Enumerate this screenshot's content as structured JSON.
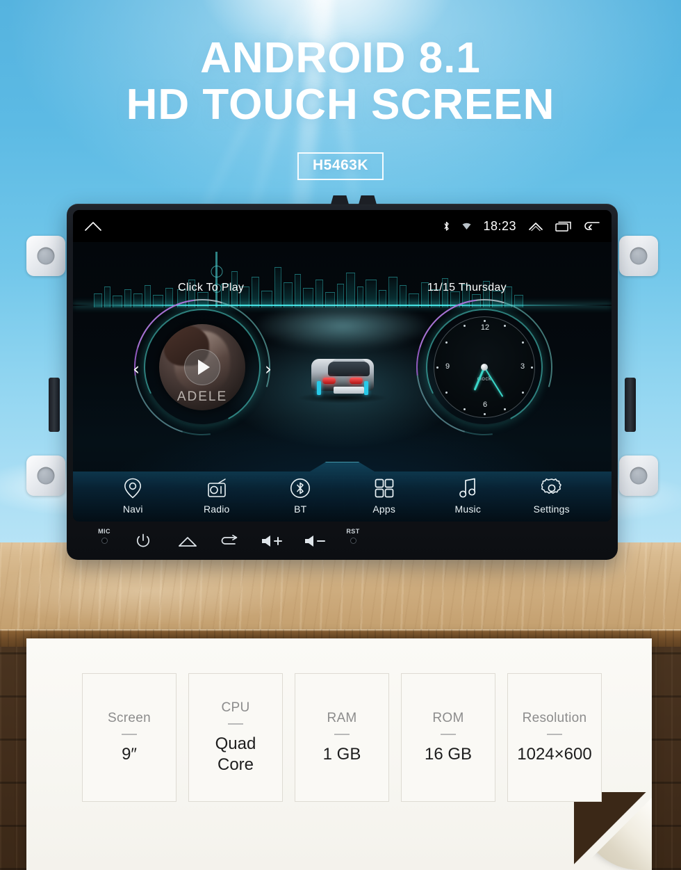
{
  "hero": {
    "line1": "ANDROID 8.1",
    "line2": "HD TOUCH SCREEN",
    "model": "H5463K"
  },
  "device": {
    "statusbar": {
      "home_icon": "home-icon",
      "bluetooth_icon": "bluetooth-icon",
      "wifi_icon": "wifi-icon",
      "time": "18:23",
      "expand_icon": "chevron-up-icon",
      "recents_icon": "recents-icon",
      "back_icon": "back-arrow-icon"
    },
    "music_widget": {
      "title": "Click To Play",
      "album_artist": "ADELE",
      "play_icon": "play-icon",
      "prev_icon": "chevron-left-icon",
      "next_icon": "chevron-right-icon"
    },
    "clock_widget": {
      "date": "11/15  Thursday",
      "face_label": "clock",
      "hour_marks": [
        "12",
        "3",
        "6",
        "9"
      ]
    },
    "dock": [
      {
        "label": "Navi",
        "icon": "location-pin-icon"
      },
      {
        "label": "Radio",
        "icon": "radio-icon"
      },
      {
        "label": "BT",
        "icon": "bluetooth-icon"
      },
      {
        "label": "Apps",
        "icon": "apps-grid-icon"
      },
      {
        "label": "Music",
        "icon": "music-note-icon"
      },
      {
        "label": "Settings",
        "icon": "gear-icon"
      }
    ],
    "buttons": [
      {
        "label": "MIC",
        "icon": "mic-pinhole-icon"
      },
      {
        "label": "",
        "icon": "power-icon"
      },
      {
        "label": "",
        "icon": "home-icon"
      },
      {
        "label": "",
        "icon": "return-arrow-icon"
      },
      {
        "label": "",
        "icon": "volume-up-icon"
      },
      {
        "label": "",
        "icon": "volume-down-icon"
      },
      {
        "label": "RST",
        "icon": "reset-pinhole-icon"
      }
    ]
  },
  "specs": [
    {
      "label": "Screen",
      "value": "9″"
    },
    {
      "label": "CPU",
      "value": "Quad\nCore"
    },
    {
      "label": "RAM",
      "value": "1 GB"
    },
    {
      "label": "ROM",
      "value": "16 GB"
    },
    {
      "label": "Resolution",
      "value": "1024×600"
    }
  ],
  "colors": {
    "sky": "#55b3df",
    "wood": "#cfae80",
    "dark_wood": "#432e1c",
    "paper": "#faf9f5",
    "accent_cyan": "#3ad6c8",
    "screen_black": "#03070b"
  }
}
